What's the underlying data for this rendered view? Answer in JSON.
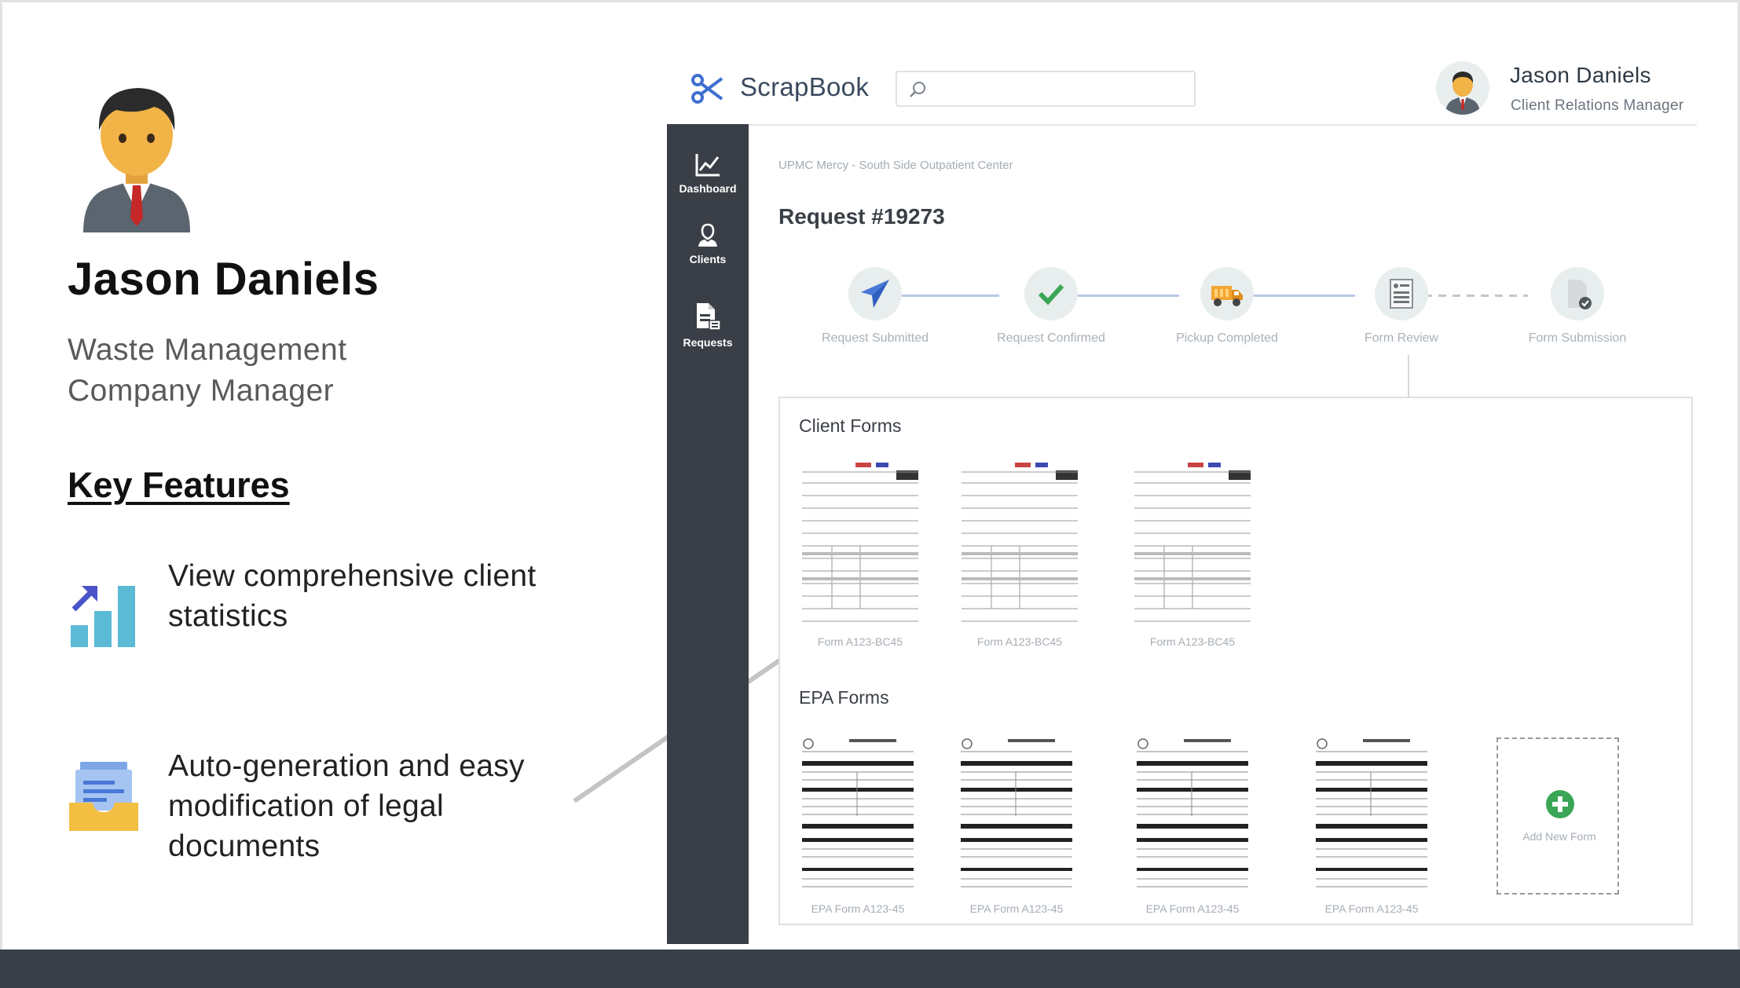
{
  "persona": {
    "name": "Jason Daniels",
    "role_line1": "Waste Management",
    "role_line2": "Company Manager",
    "features_title": "Key Features",
    "features": [
      {
        "icon": "bar-chart-up-icon",
        "line1": "View comprehensive client",
        "line2": "statistics"
      },
      {
        "icon": "document-tray-icon",
        "line1": "Auto-generation and easy",
        "line2": "modification of legal",
        "line3": "documents"
      }
    ]
  },
  "app": {
    "logo_icon": "scissors-icon",
    "name": "ScrapBook",
    "search": {
      "value": "",
      "placeholder": "",
      "icon": "search-icon"
    },
    "user": {
      "name": "Jason Daniels",
      "role": "Client Relations Manager"
    },
    "nav": [
      {
        "label": "Dashboard",
        "icon": "line-chart-icon"
      },
      {
        "label": "Clients",
        "icon": "user-icon"
      },
      {
        "label": "Requests",
        "icon": "document-list-icon"
      }
    ],
    "breadcrumb": "UPMC Mercy - South Side Outpatient Center",
    "request_title": "Request #19273",
    "steps": [
      {
        "label": "Request Submitted",
        "icon": "paper-plane-icon",
        "status": "done"
      },
      {
        "label": "Request Confirmed",
        "icon": "checkmark-icon",
        "status": "done"
      },
      {
        "label": "Pickup Completed",
        "icon": "truck-icon",
        "status": "done"
      },
      {
        "label": "Form Review",
        "icon": "form-icon",
        "status": "current"
      },
      {
        "label": "Form Submission",
        "icon": "document-check-icon",
        "status": "pending"
      }
    ],
    "client_forms_title": "Client Forms",
    "client_forms": [
      {
        "caption": "Form A123-BC45"
      },
      {
        "caption": "Form A123-BC45"
      },
      {
        "caption": "Form A123-BC45"
      }
    ],
    "epa_forms_title": "EPA Forms",
    "epa_forms": [
      {
        "caption": "EPA Form A123-45"
      },
      {
        "caption": "EPA Form A123-45"
      },
      {
        "caption": "EPA Form A123-45"
      },
      {
        "caption": "EPA Form A123-45"
      }
    ],
    "add_form_label": "Add New Form"
  },
  "colors": {
    "sidebar": "#3a3f47",
    "accent_blue": "#4a78d6",
    "success_green": "#3aa655",
    "stat_teal": "#5bbad5",
    "folder_yellow": "#f3bf43"
  }
}
